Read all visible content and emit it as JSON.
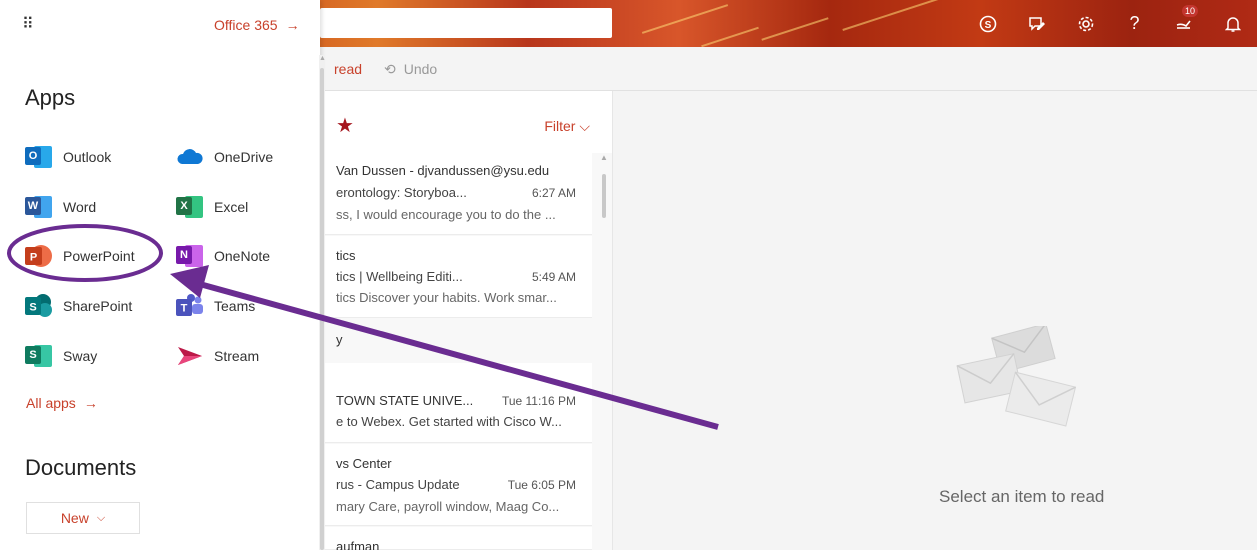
{
  "launcher": {
    "office_link": "Office 365",
    "office_arrow": "→",
    "apps_title": "Apps",
    "apps": [
      {
        "label": "Outlook",
        "letter": "O",
        "color": "#0f6cbd",
        "icon": "outlook-icon"
      },
      {
        "label": "OneDrive",
        "letter": "",
        "color": "#0f78d4",
        "icon": "onedrive-icon"
      },
      {
        "label": "Word",
        "letter": "W",
        "color": "#2b579a",
        "icon": "word-icon"
      },
      {
        "label": "Excel",
        "letter": "X",
        "color": "#217346",
        "icon": "excel-icon"
      },
      {
        "label": "PowerPoint",
        "letter": "P",
        "color": "#d24726",
        "icon": "powerpoint-icon"
      },
      {
        "label": "OneNote",
        "letter": "N",
        "color": "#7719aa",
        "icon": "onenote-icon"
      },
      {
        "label": "SharePoint",
        "letter": "S",
        "color": "#0b7d83",
        "icon": "sharepoint-icon"
      },
      {
        "label": "Teams",
        "letter": "T",
        "color": "#5059c9",
        "icon": "teams-icon"
      },
      {
        "label": "Sway",
        "letter": "S",
        "color": "#0f7b5f",
        "icon": "sway-icon"
      },
      {
        "label": "Stream",
        "letter": "",
        "color": "#bc1948",
        "icon": "stream-icon"
      }
    ],
    "all_apps": "All apps",
    "all_apps_arrow": "→",
    "documents_title": "Documents",
    "new_button": "New"
  },
  "header": {
    "notification_count": "10",
    "icons": [
      "skype-icon",
      "feedback-icon",
      "settings-icon",
      "help-icon",
      "whats-new-icon",
      "bell-icon"
    ],
    "help_glyph": "?"
  },
  "command_bar": {
    "read": "read",
    "undo": "Undo"
  },
  "message_list": {
    "filter": "Filter",
    "messages": [
      {
        "line1": "Van Dussen - djvandussen@ysu.edu",
        "line2": "erontology: Storyboa...",
        "time": "6:27 AM",
        "line3": "ss, I would encourage you to do the ..."
      },
      {
        "line1": "tics",
        "line2": "tics | Wellbeing Editi...",
        "time": "5:49 AM",
        "line3": "tics Discover your habits. Work smar..."
      },
      {
        "line1": "TOWN STATE UNIVE...",
        "line2": "e to Webex. Get started with Cisco W...",
        "time": "Tue 11:16 PM",
        "line3": ""
      },
      {
        "line1": "vs Center",
        "line2": "rus - Campus Update",
        "time": "Tue 6:05 PM",
        "line3": "mary Care, payroll window, Maag Co..."
      },
      {
        "line1": "aufman",
        "line2": "",
        "time": "",
        "line3": ""
      }
    ],
    "group_label": "y"
  },
  "reading_pane": {
    "empty_text": "Select an item to read"
  },
  "annotation": {
    "color": "#6a2c91"
  }
}
